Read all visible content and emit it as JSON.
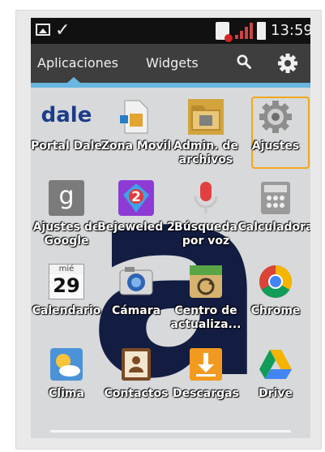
{
  "status_bar": {
    "time": "13:59"
  },
  "tabs": [
    {
      "label": "Aplicaciones",
      "selected": true
    },
    {
      "label": "Widgets",
      "selected": false
    }
  ],
  "toolbar": {
    "search_icon": "search-icon",
    "settings_icon": "gear-icon"
  },
  "apps": [
    {
      "label": "Portal Dale",
      "icon": "dale-logo"
    },
    {
      "label": "Zona Movil",
      "icon": "sim-card-icon"
    },
    {
      "label": "Admin. de archivos",
      "icon": "folder-icon"
    },
    {
      "label": "Ajustes",
      "icon": "settings-gear-icon",
      "highlighted": true
    },
    {
      "label": "Ajustes de Google",
      "icon": "google-settings-icon"
    },
    {
      "label": "Bejeweled 2",
      "icon": "bejeweled-icon"
    },
    {
      "label": "Búsqueda por voz",
      "icon": "microphone-icon"
    },
    {
      "label": "Calculadora",
      "icon": "calculator-icon"
    },
    {
      "label": "Calendario",
      "icon": "calendar-icon",
      "calendar_day": "mié",
      "calendar_date": "29"
    },
    {
      "label": "Cámara",
      "icon": "camera-icon"
    },
    {
      "label": "Centro de actualiza...",
      "icon": "update-center-icon"
    },
    {
      "label": "Chrome",
      "icon": "chrome-icon"
    },
    {
      "label": "Clima",
      "icon": "weather-icon"
    },
    {
      "label": "Contactos",
      "icon": "contacts-icon"
    },
    {
      "label": "Descargas",
      "icon": "download-icon"
    },
    {
      "label": "Drive",
      "icon": "drive-icon"
    }
  ],
  "dale_logo_text": "dale",
  "google_settings_text": "g",
  "watermark_letter": "a",
  "colors": {
    "tab_accent": "#67b7e0",
    "highlight_border": "#f0a81a",
    "wallpaper_letter": "#131d42"
  }
}
